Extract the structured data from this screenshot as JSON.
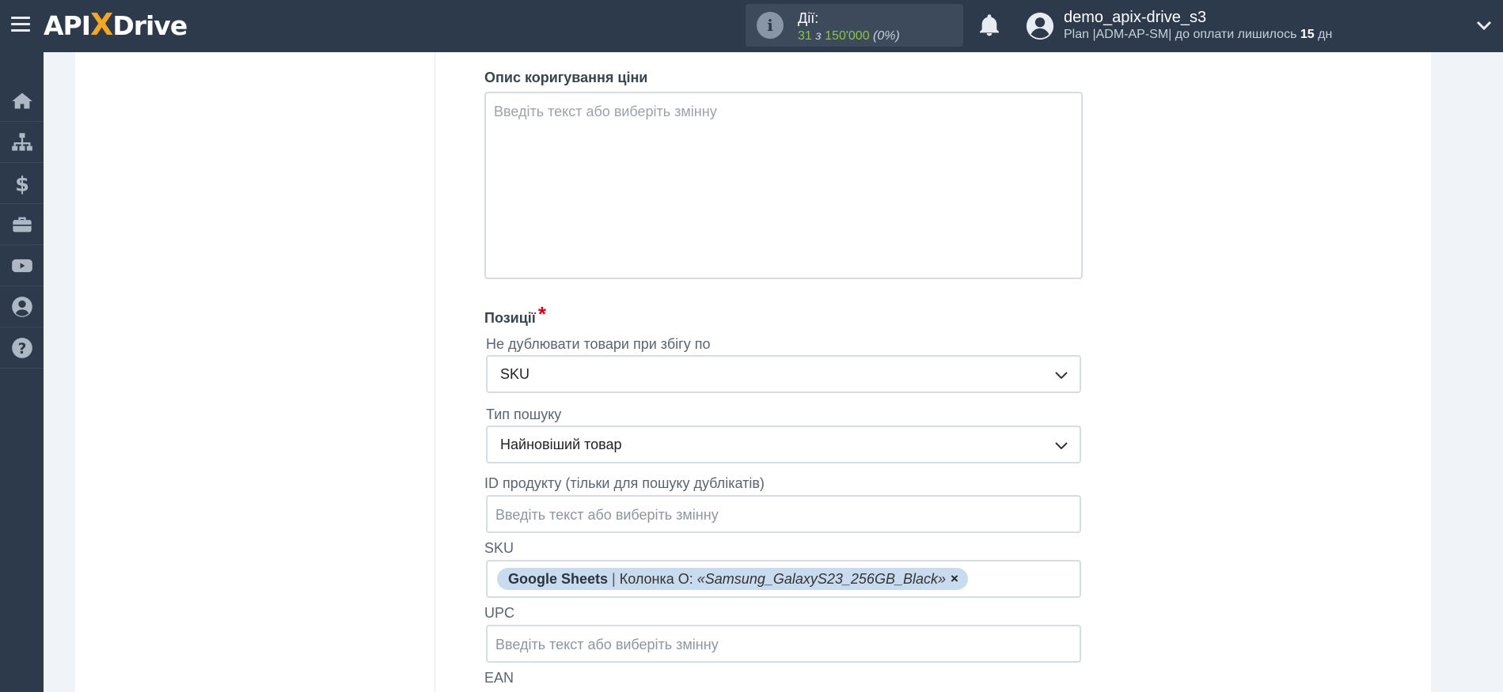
{
  "header": {
    "logo_api": "API",
    "logo_x": "X",
    "logo_drive": "Drive",
    "actions_label": "Дії:",
    "actions_used": "31",
    "actions_of": "з",
    "actions_total": "150'000",
    "actions_pct": "(0%)",
    "username": "demo_apix-drive_s3",
    "plan_prefix": "Plan |ADM-AP-SM| до оплати лишилось",
    "plan_days": "15",
    "plan_suffix": "дн"
  },
  "sidebar": {
    "items": [
      "home-icon",
      "sitemap-icon",
      "dollar-icon",
      "briefcase-icon",
      "youtube-icon",
      "user-circle-icon",
      "help-icon"
    ]
  },
  "form": {
    "price_desc_label": "Опис коригування ціни",
    "price_desc_placeholder": "Введіть текст або виберіть змінну",
    "positions_label": "Позиції",
    "positions_required": "*",
    "no_dup_label": "Не дублювати товари при збігу по",
    "no_dup_value": "SKU",
    "search_type_label": "Тип пошуку",
    "search_type_value": "Найновіший товар",
    "product_id_label": "ID продукту (тільки для пошуку дублікатів)",
    "product_id_placeholder": "Введіть текст або виберіть змінну",
    "sku_label": "SKU",
    "sku_tag_source": "Google Sheets",
    "sku_tag_sep": "|",
    "sku_tag_column": "Колонка O:",
    "sku_tag_value": "«Samsung_GalaxyS23_256GB_Black»",
    "sku_tag_remove": "×",
    "upc_label": "UPC",
    "upc_placeholder": "Введіть текст або виберіть змінну",
    "ean_label": "EAN"
  },
  "colors": {
    "topbar": "#2c3a4b",
    "accent_green": "#8bc34a",
    "logo_x": "#f5a623",
    "tag_bg": "#c9dcef",
    "required": "#d0021b"
  }
}
